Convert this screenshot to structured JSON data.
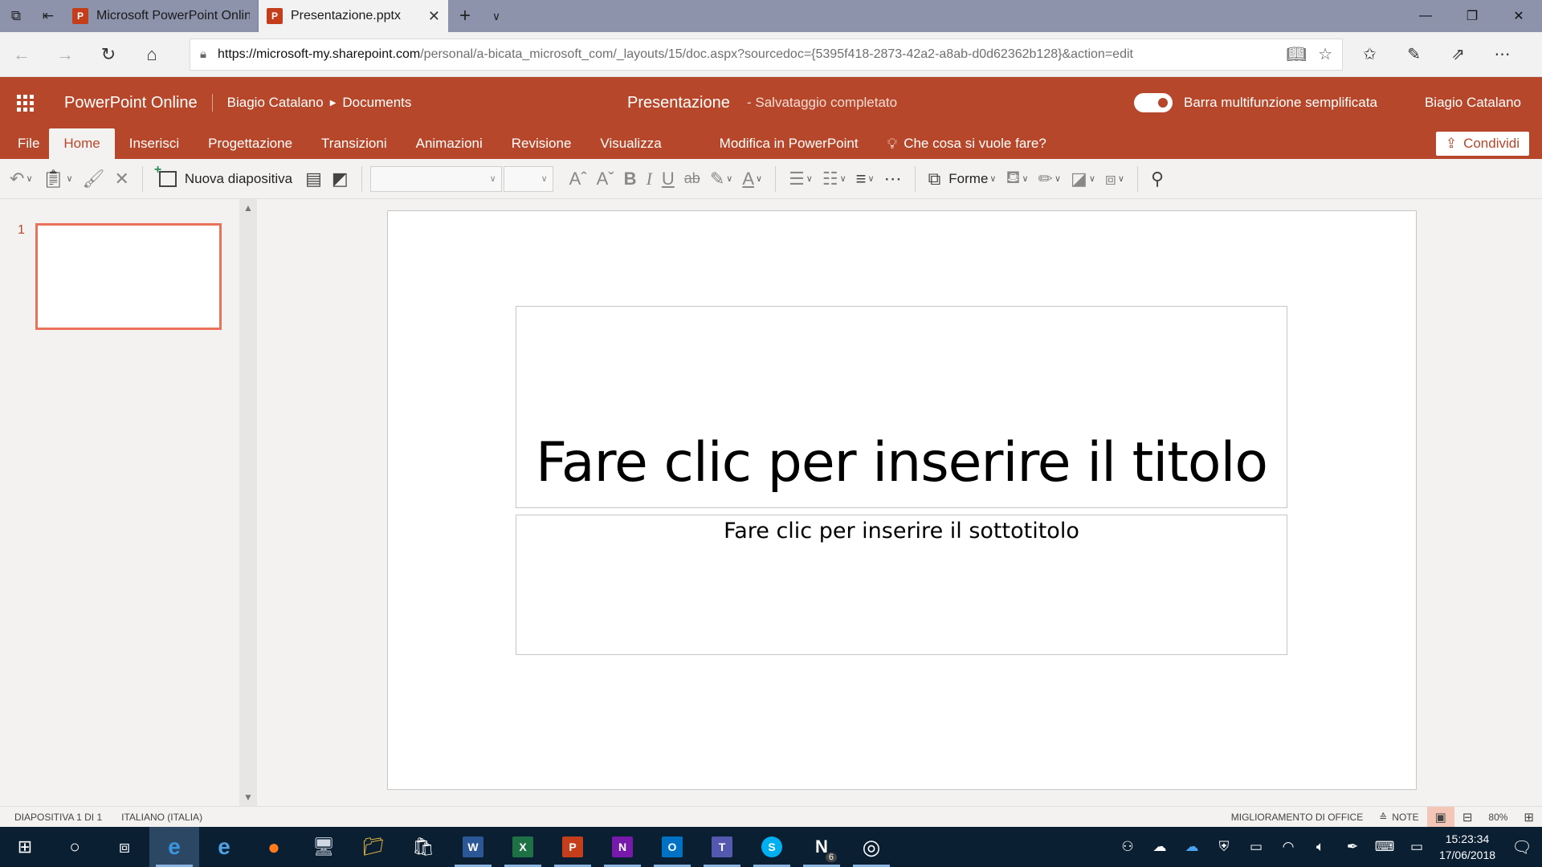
{
  "browser": {
    "tabs": [
      {
        "label": "Microsoft PowerPoint Onlin",
        "icon": "powerpoint-icon",
        "active": false
      },
      {
        "label": "Presentazione.pptx",
        "icon": "powerpoint-icon",
        "active": true
      }
    ],
    "tab_close_glyph": "✕",
    "url_host": "https://microsoft-my.sharepoint.com",
    "url_path": "/personal/a-bicata_microsoft_com/_layouts/15/doc.aspx?sourcedoc={5395f418-2873-42a2-a8ab-d0d62362b128}&action=edit"
  },
  "app": {
    "name": "PowerPoint Online",
    "breadcrumb_user": "Biagio Catalano",
    "breadcrumb_folder": "Documents",
    "doc_title": "Presentazione",
    "save_status": "-  Salvataggio completato",
    "simplified_ribbon_label": "Barra multifunzione semplificata",
    "simplified_ribbon_on": true,
    "user_name": "Biagio Catalano",
    "accent_color": "#b7472a"
  },
  "ribbon": {
    "tabs": [
      "File",
      "Home",
      "Inserisci",
      "Progettazione",
      "Transizioni",
      "Animazioni",
      "Revisione",
      "Visualizza"
    ],
    "active_tab": "Home",
    "edit_in_app": "Modifica in PowerPoint",
    "tell_me": "Che cosa si vuole fare?",
    "share": "Condividi",
    "new_slide": "Nuova diapositiva",
    "shapes": "Forme"
  },
  "slides_pane": {
    "slide_number": "1"
  },
  "slide": {
    "title_placeholder": "Fare clic per inserire il titolo",
    "subtitle_placeholder": "Fare clic per inserire il sottotitolo"
  },
  "statusbar": {
    "slide_count": "DIAPOSITIVA 1 DI 1",
    "language": "ITALIANO (ITALIA)",
    "improve": "MIGLIORAMENTO DI OFFICE",
    "notes": "NOTE",
    "zoom": "80%"
  },
  "taskbar": {
    "time": "15:23:34",
    "date": "17/06/2018",
    "notification_badge": "6"
  }
}
